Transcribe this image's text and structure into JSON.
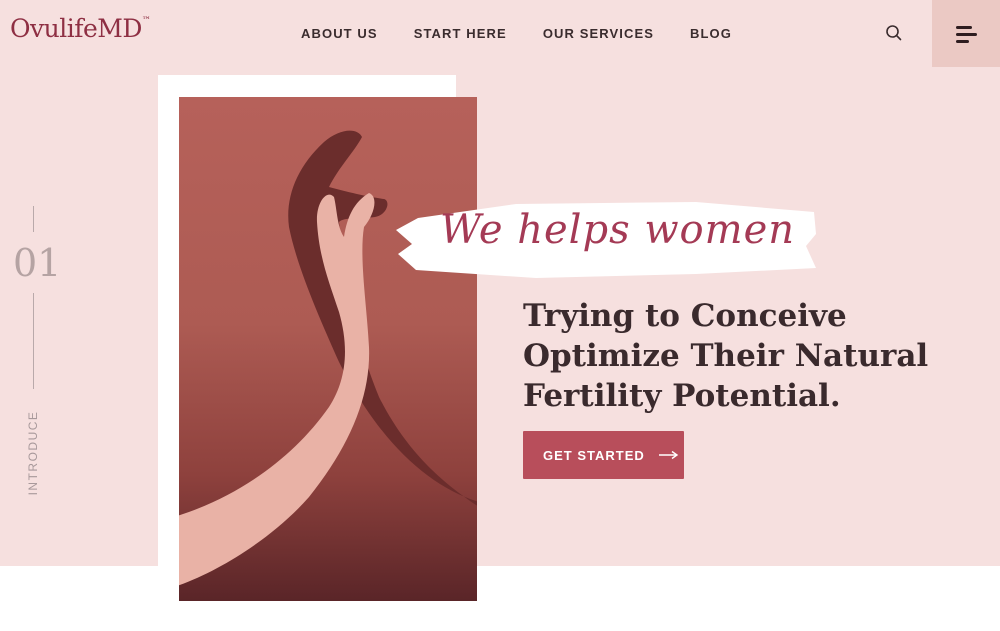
{
  "brand": {
    "name": "OvulifeMD",
    "tm": "™"
  },
  "nav": {
    "items": [
      {
        "label": "ABOUT US"
      },
      {
        "label": "START HERE"
      },
      {
        "label": "OUR SERVICES"
      },
      {
        "label": "BLOG"
      }
    ]
  },
  "icons": {
    "search": "search-icon",
    "menu": "hamburger-menu-icon",
    "arrow": "arrow-right-icon"
  },
  "hero": {
    "slide_number": "01",
    "side_label": "INTRODUCE",
    "script_heading": "We helps women",
    "headline_lines": [
      "Trying to Conceive",
      "Optimize Their Natural",
      "Fertility Potential."
    ],
    "cta_label": "GET STARTED"
  },
  "colors": {
    "brand": "#8e2f43",
    "hero_bg": "#f6e0df",
    "menu_bg": "#ebc9c4",
    "cta": "#b84e5b",
    "script": "#a43a55",
    "headline": "#3a2a2d"
  }
}
